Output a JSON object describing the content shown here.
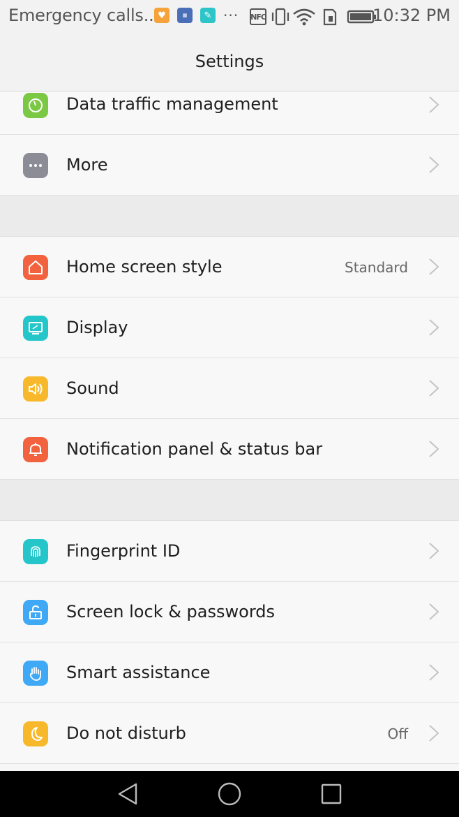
{
  "status_bar": {
    "carrier": "Emergency calls...",
    "nfc_label": "NFC",
    "time": "10:32 PM"
  },
  "header": {
    "title": "Settings"
  },
  "sections": [
    {
      "items": [
        {
          "label": "Data traffic management",
          "value": "",
          "icon": "gauge-icon",
          "color": "#7ac843"
        },
        {
          "label": "More",
          "value": "",
          "icon": "more-dots-icon",
          "color": "#8c8c96"
        }
      ]
    },
    {
      "items": [
        {
          "label": "Home screen style",
          "value": "Standard",
          "icon": "home-icon",
          "color": "#f2623e"
        },
        {
          "label": "Display",
          "value": "",
          "icon": "display-icon",
          "color": "#24c6c9"
        },
        {
          "label": "Sound",
          "value": "",
          "icon": "speaker-icon",
          "color": "#f7b92b"
        },
        {
          "label": "Notification panel & status bar",
          "value": "",
          "icon": "bell-icon",
          "color": "#f2623e"
        }
      ]
    },
    {
      "items": [
        {
          "label": "Fingerprint ID",
          "value": "",
          "icon": "fingerprint-icon",
          "color": "#24c6c9"
        },
        {
          "label": "Screen lock & passwords",
          "value": "",
          "icon": "lock-icon",
          "color": "#3fa9f5"
        },
        {
          "label": "Smart assistance",
          "value": "",
          "icon": "hand-icon",
          "color": "#3fa9f5"
        },
        {
          "label": "Do not disturb",
          "value": "Off",
          "icon": "moon-icon",
          "color": "#f7b92b"
        }
      ]
    }
  ]
}
